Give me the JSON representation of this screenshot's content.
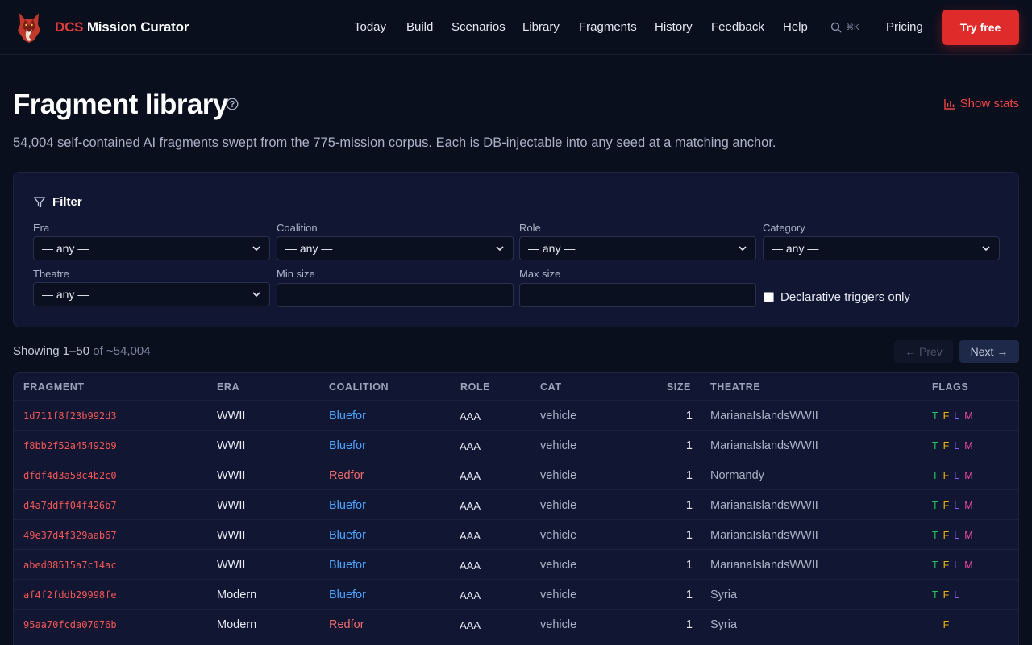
{
  "brand": {
    "accent": "DCS",
    "rest": "Mission Curator"
  },
  "nav": [
    "Today",
    "Build",
    "Scenarios",
    "Library",
    "Fragments",
    "History",
    "Feedback",
    "Help"
  ],
  "search": {
    "shortcut": "⌘K"
  },
  "pricing": "Pricing",
  "try_free": "Try free",
  "page": {
    "title": "Fragment library",
    "show_stats": "Show stats",
    "subtitle": "54,004 self-contained AI fragments swept from the 775-mission corpus. Each is DB-injectable into any seed at a matching anchor."
  },
  "filter": {
    "title": "Filter",
    "era_label": "Era",
    "era_value": "— any —",
    "coalition_label": "Coalition",
    "coalition_value": "— any —",
    "role_label": "Role",
    "role_value": "— any —",
    "category_label": "Category",
    "category_value": "— any —",
    "theatre_label": "Theatre",
    "theatre_value": "— any —",
    "min_size_label": "Min size",
    "min_size_value": "",
    "max_size_label": "Max size",
    "max_size_value": "",
    "declarative_label": "Declarative triggers only"
  },
  "listing": {
    "showing": "Showing 1–50",
    "total": "of ~54,004",
    "prev": "← Prev",
    "next": "Next →"
  },
  "table": {
    "headers": [
      "FRAGMENT",
      "ERA",
      "COALITION",
      "ROLE",
      "CAT",
      "SIZE",
      "THEATRE",
      "FLAGS"
    ],
    "rows": [
      {
        "fragment": "1d711f8f23b992d3",
        "era": "WWII",
        "coalition": "Bluefor",
        "role": "AAA",
        "cat": "vehicle",
        "size": "1",
        "theatre": "MarianaIslandsWWII",
        "flags": [
          "T",
          "F",
          "L",
          "M"
        ]
      },
      {
        "fragment": "f8bb2f52a45492b9",
        "era": "WWII",
        "coalition": "Bluefor",
        "role": "AAA",
        "cat": "vehicle",
        "size": "1",
        "theatre": "MarianaIslandsWWII",
        "flags": [
          "T",
          "F",
          "L",
          "M"
        ]
      },
      {
        "fragment": "dfdf4d3a58c4b2c0",
        "era": "WWII",
        "coalition": "Redfor",
        "role": "AAA",
        "cat": "vehicle",
        "size": "1",
        "theatre": "Normandy",
        "flags": [
          "T",
          "F",
          "L",
          "M"
        ]
      },
      {
        "fragment": "d4a7ddff04f426b7",
        "era": "WWII",
        "coalition": "Bluefor",
        "role": "AAA",
        "cat": "vehicle",
        "size": "1",
        "theatre": "MarianaIslandsWWII",
        "flags": [
          "T",
          "F",
          "L",
          "M"
        ]
      },
      {
        "fragment": "49e37d4f329aab67",
        "era": "WWII",
        "coalition": "Bluefor",
        "role": "AAA",
        "cat": "vehicle",
        "size": "1",
        "theatre": "MarianaIslandsWWII",
        "flags": [
          "T",
          "F",
          "L",
          "M"
        ]
      },
      {
        "fragment": "abed08515a7c14ac",
        "era": "WWII",
        "coalition": "Bluefor",
        "role": "AAA",
        "cat": "vehicle",
        "size": "1",
        "theatre": "MarianaIslandsWWII",
        "flags": [
          "T",
          "F",
          "L",
          "M"
        ]
      },
      {
        "fragment": "af4f2fddb29998fe",
        "era": "Modern",
        "coalition": "Bluefor",
        "role": "AAA",
        "cat": "vehicle",
        "size": "1",
        "theatre": "Syria",
        "flags": [
          "T",
          "F",
          "L"
        ]
      },
      {
        "fragment": "95aa70fcda07076b",
        "era": "Modern",
        "coalition": "Redfor",
        "role": "AAA",
        "cat": "vehicle",
        "size": "1",
        "theatre": "Syria",
        "flags": [
          "F"
        ]
      }
    ]
  },
  "colors": {
    "accent": "#e02b2b",
    "bluefor": "#4da3ff",
    "redfor": "#f26b6b",
    "flag_t": "#22c55e",
    "flag_f": "#eab308",
    "flag_l": "#8b5cf6",
    "flag_m": "#ec4899"
  }
}
